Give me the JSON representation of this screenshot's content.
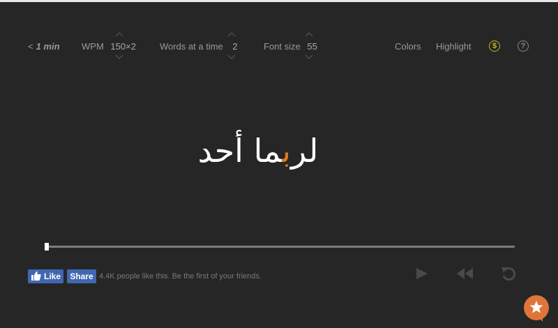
{
  "toolbar": {
    "back_label": "1 min",
    "wpm_label": "WPM",
    "wpm_value": "150×2",
    "words_label": "Words at a time",
    "words_value": "2",
    "font_label": "Font size",
    "font_value": "55",
    "colors_label": "Colors",
    "highlight_label": "Highlight",
    "dollar_symbol": "$",
    "help_symbol": "?"
  },
  "reader": {
    "word_before": "لر",
    "word_highlight": "ب",
    "word_after": "ما أحد",
    "highlight_color": "#e07a1f",
    "progress": 0.0
  },
  "social": {
    "like_label": "Like",
    "share_label": "Share",
    "like_text": "4.4K people like this. Be the first of your friends."
  },
  "controls": {
    "icons": [
      "play-icon",
      "rewind-icon",
      "restart-icon"
    ]
  }
}
